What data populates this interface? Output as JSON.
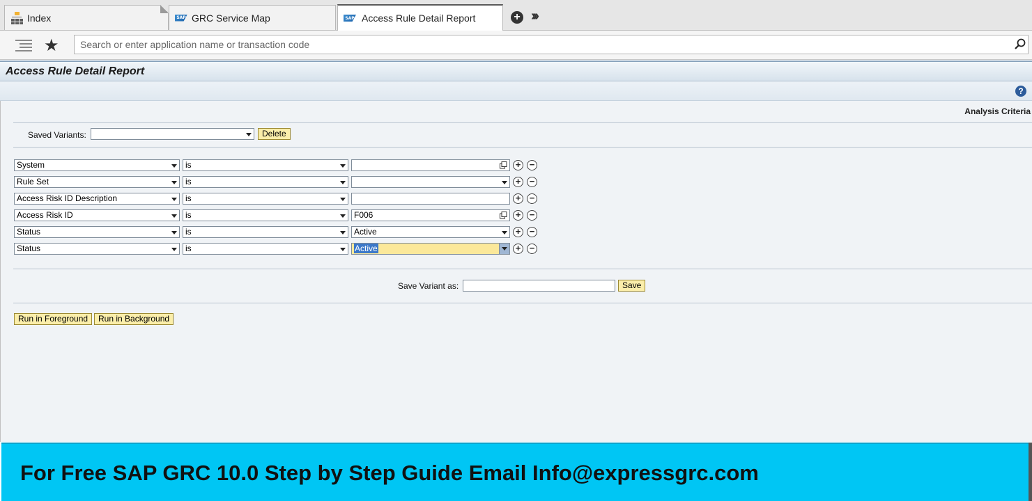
{
  "tabs": [
    {
      "label": "Index",
      "icon": "sitemap-icon"
    },
    {
      "label": "GRC Service Map",
      "icon": "sap-logo-icon"
    },
    {
      "label": "Access Rule Detail Report",
      "icon": "sap-logo-icon"
    }
  ],
  "search": {
    "placeholder": "Search or enter application name or transaction code"
  },
  "page": {
    "title": "Access Rule Detail Report",
    "section_title": "Analysis Criteria"
  },
  "variants": {
    "label": "Saved Variants:",
    "value": "",
    "delete_label": "Delete"
  },
  "criteria": [
    {
      "field": "System",
      "operator": "is",
      "value": ""
    },
    {
      "field": "Rule Set",
      "operator": "is",
      "value": ""
    },
    {
      "field": "Access Risk ID Description",
      "operator": "is",
      "value": ""
    },
    {
      "field": "Access Risk ID",
      "operator": "is",
      "value": "F006"
    },
    {
      "field": "Status",
      "operator": "is",
      "value": "Active"
    },
    {
      "field": "Status",
      "operator": "is",
      "value": "Active"
    }
  ],
  "save_variant": {
    "label": "Save Variant as:",
    "value": "",
    "save_label": "Save"
  },
  "run": {
    "foreground_label": "Run in Foreground",
    "background_label": "Run in Background"
  },
  "banner": {
    "text": "For Free SAP GRC 10.0 Step by Step Guide Email Info@expressgrc.com"
  },
  "colors": {
    "banner": "#00c6f4",
    "button": "#fbeeaa",
    "highlight": "#fbe89a",
    "selection": "#3b78c9"
  }
}
